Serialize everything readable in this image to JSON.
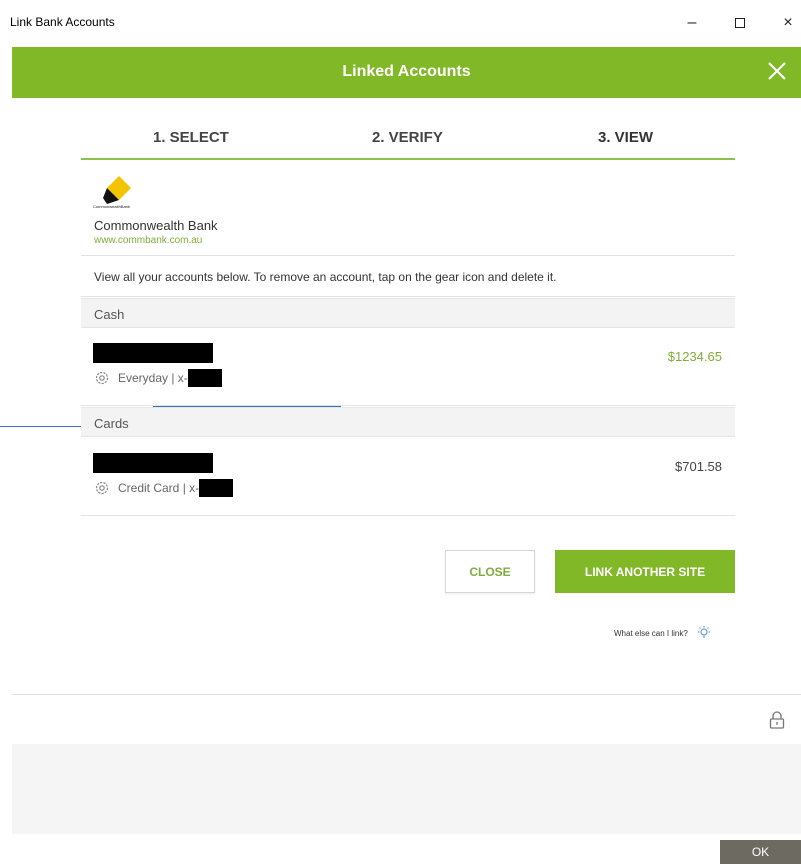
{
  "window": {
    "title": "Link Bank Accounts",
    "minimize_label": "–",
    "close_label": "×"
  },
  "header": {
    "title": "Linked Accounts"
  },
  "steps": [
    {
      "label": "1. SELECT"
    },
    {
      "label": "2. VERIFY"
    },
    {
      "label": "3. VIEW"
    }
  ],
  "bank": {
    "logo_caption": "CommonwealthBank",
    "name": "Commonwealth Bank",
    "url": "www.commbank.com.au"
  },
  "instructions": "View all your accounts below. To remove an account, tap on the gear icon and delete it.",
  "sections": [
    {
      "title": "Cash",
      "account": {
        "type": "Everyday | x-",
        "amount": "$1234.65"
      }
    },
    {
      "title": "Cards",
      "account": {
        "type": "Credit Card | x-",
        "amount": "$701.58"
      }
    }
  ],
  "buttons": {
    "close": "CLOSE",
    "link_another": "LINK ANOTHER SITE",
    "ok": "OK"
  },
  "help_text": "What else can I link?",
  "colors": {
    "brand_green": "#80b828",
    "link_green": "#7fae3a",
    "logo_yellow": "#f5c400"
  }
}
